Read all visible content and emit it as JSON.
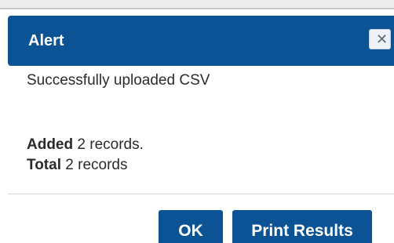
{
  "dialog": {
    "title": "Alert",
    "close_icon": "close-icon",
    "message": "Successfully uploaded CSV",
    "results": {
      "added_label": "Added",
      "added_value": "2 records.",
      "total_label": "Total",
      "total_value": "2 records"
    },
    "buttons": {
      "ok_label": "OK",
      "print_label": "Print Results"
    }
  },
  "colors": {
    "header": "#0b5394",
    "button": "#0b5394",
    "text": "#2b2b2b"
  }
}
